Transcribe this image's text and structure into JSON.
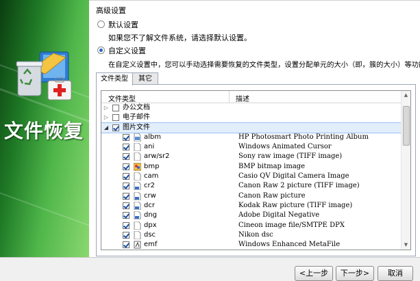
{
  "colors": {
    "accent": "#2a64c8",
    "sidebar_dark": "#0b3d10",
    "sidebar_light": "#8ad86f"
  },
  "sidebar": {
    "title": "文件恢复",
    "icon": "recycle-bin-medkit-icon"
  },
  "main": {
    "section_title": "高级设置",
    "options": [
      {
        "label": "默认设置",
        "description": "如果您不了解文件系统，请选择默认设置。",
        "checked": false
      },
      {
        "label": "自定义设置",
        "description": "在自定义设置中，您可以手动选择需要恢复的文件类型，设置分配单元的大小（即，簇的大小）等功能。",
        "checked": true
      }
    ],
    "tabs": [
      {
        "label": "文件类型",
        "active": true
      },
      {
        "label": "其它",
        "active": false
      }
    ],
    "list": {
      "columns": {
        "type": "文件类型",
        "desc": "描述"
      },
      "groups": [
        {
          "label": "办公文档",
          "expanded": false,
          "checked": false
        },
        {
          "label": "电子邮件",
          "expanded": false,
          "checked": false
        },
        {
          "label": "图片文件",
          "expanded": true,
          "checked": true
        }
      ],
      "items": [
        {
          "ext": "albm",
          "desc": "HP Photosmart Photo Printing Album",
          "checked": true
        },
        {
          "ext": "ani",
          "desc": "Windows Animated Cursor",
          "checked": true
        },
        {
          "ext": "arw/sr2",
          "desc": "Sony raw image (TIFF image)",
          "checked": true
        },
        {
          "ext": "bmp",
          "desc": "BMP bitmap image",
          "checked": true
        },
        {
          "ext": "cam",
          "desc": "Casio QV Digital Camera Image",
          "checked": true
        },
        {
          "ext": "cr2",
          "desc": "Canon Raw 2 picture (TIFF image)",
          "checked": true
        },
        {
          "ext": "crw",
          "desc": "Canon Raw picture",
          "checked": true
        },
        {
          "ext": "dcr",
          "desc": "Kodak Raw picture (TIFF image)",
          "checked": true
        },
        {
          "ext": "dng",
          "desc": "Adobe Digital Negative",
          "checked": true
        },
        {
          "ext": "dpx",
          "desc": "Cineon image file/SMTPE DPX",
          "checked": true
        },
        {
          "ext": "dsc",
          "desc": "Nikon dsc",
          "checked": true
        },
        {
          "ext": "emf",
          "desc": "Windows Enhanced MetaFile",
          "checked": true
        }
      ]
    }
  },
  "footer": {
    "prev": "<上一步",
    "next": "下一步>",
    "cancel": "取消"
  }
}
